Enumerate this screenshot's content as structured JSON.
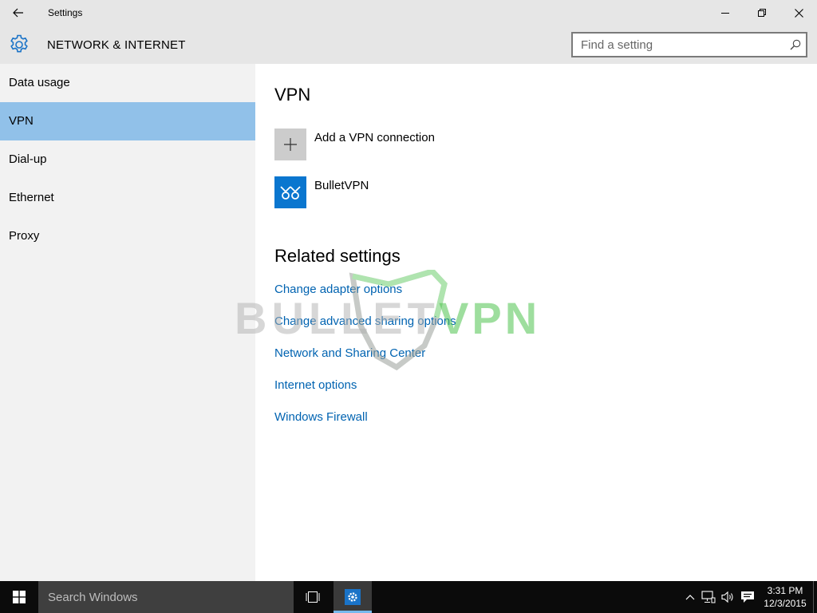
{
  "window": {
    "title": "Settings",
    "back_icon": "back-arrow-icon",
    "minimize_icon": "minimize-icon",
    "restore_icon": "restore-icon",
    "close_icon": "close-icon"
  },
  "header": {
    "icon": "gear-icon",
    "title": "NETWORK & INTERNET",
    "search_placeholder": "Find a setting",
    "search_value": "",
    "search_icon": "magnifier-icon"
  },
  "sidebar": {
    "selected": "VPN",
    "items": [
      {
        "label": "Data usage"
      },
      {
        "label": "VPN"
      },
      {
        "label": "Dial-up"
      },
      {
        "label": "Ethernet"
      },
      {
        "label": "Proxy"
      }
    ]
  },
  "main": {
    "heading": "VPN",
    "connections": [
      {
        "label": "Add a VPN connection",
        "icon": "plus-icon"
      },
      {
        "label": "BulletVPN",
        "icon": "bulletvpn-logo-icon"
      }
    ],
    "related_heading": "Related settings",
    "related_links": [
      {
        "label": "Change adapter options"
      },
      {
        "label": "Change advanced sharing options"
      },
      {
        "label": "Network and Sharing Center"
      },
      {
        "label": "Internet options"
      },
      {
        "label": "Windows Firewall"
      }
    ]
  },
  "watermark": {
    "text_left": "BULLET",
    "text_right": "VPN",
    "color_left": "#b0b0b0",
    "color_right": "#4ec34e"
  },
  "taskbar": {
    "start_icon": "windows-logo-icon",
    "search_placeholder": "Search Windows",
    "taskview_icon": "task-view-icon",
    "app_icon": "settings-gear-icon",
    "tray_icons": [
      "chevron-up-icon",
      "network-icon",
      "volume-icon",
      "action-center-icon"
    ],
    "time": "3:31 PM",
    "date": "12/3/2015"
  },
  "colors": {
    "chrome_bg": "#e6e6e6",
    "sidebar_bg": "#f2f2f2",
    "selected_bg": "#91c1e9",
    "link": "#0063b1",
    "accent": "#0a76cf",
    "taskbar_bg": "#0b0b0b"
  }
}
